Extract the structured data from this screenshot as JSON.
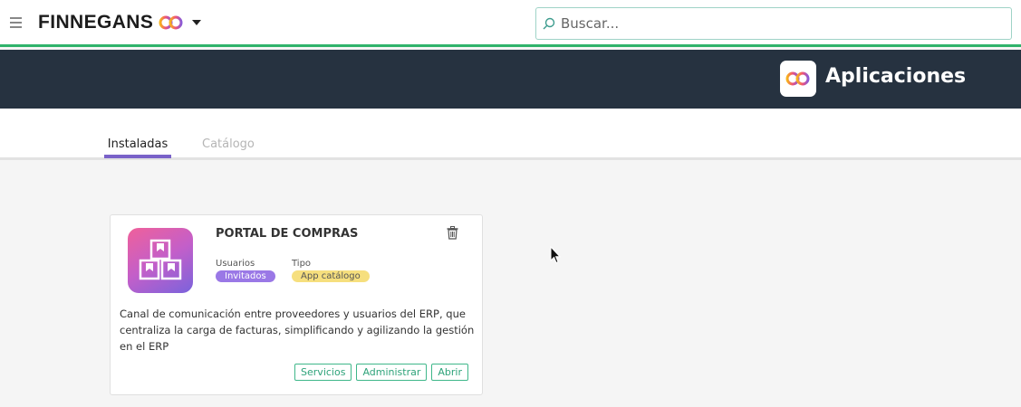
{
  "header": {
    "brand_name": "FINNEGANS",
    "search": {
      "placeholder": "Buscar..."
    }
  },
  "banner": {
    "title": "Aplicaciones"
  },
  "tabs": [
    {
      "label": "Instaladas",
      "active": true
    },
    {
      "label": "Catálogo",
      "active": false
    }
  ],
  "app_card": {
    "title": "PORTAL DE COMPRAS",
    "users_label": "Usuarios",
    "users_value": "Invitados",
    "type_label": "Tipo",
    "type_value": "App catálogo",
    "description": "Canal de comunicación entre proveedores y usuarios del ERP, que centraliza la carga de facturas, simplificando y agilizando la gestión en el ERP",
    "buttons": {
      "services": "Servicios",
      "admin": "Administrar",
      "open": "Abrir"
    }
  },
  "colors": {
    "accent_green": "#2fb36b",
    "banner_bg": "#263240",
    "tab_active": "#7a62c9",
    "badge_users": "#9a78e6",
    "badge_type": "#f6df7e",
    "button_green": "#3fb78a"
  },
  "icons": [
    "hamburger-icon",
    "brand-logo-icon",
    "chevron-down-icon",
    "search-icon",
    "apps-logo-icon",
    "boxes-icon",
    "trash-icon",
    "mouse-cursor"
  ]
}
